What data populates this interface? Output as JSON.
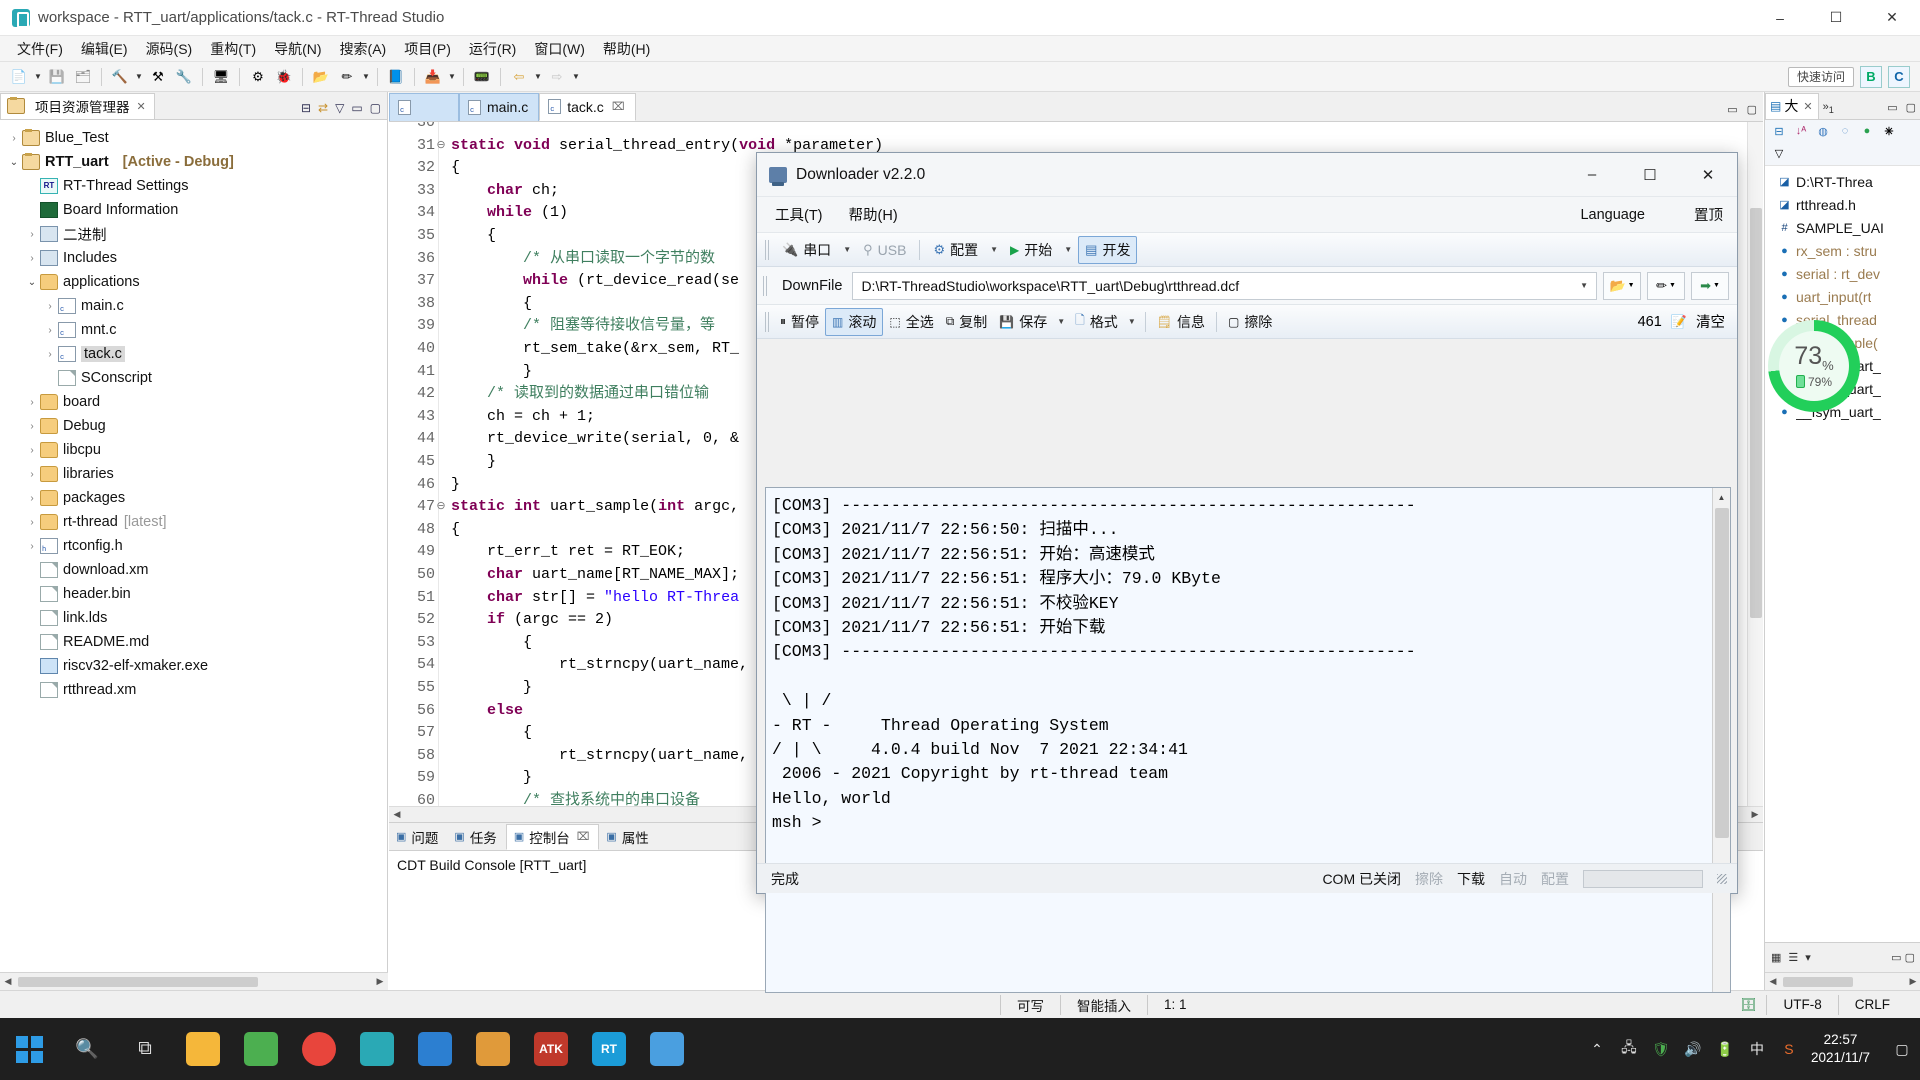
{
  "titlebar": {
    "title": "workspace - RTT_uart/applications/tack.c - RT-Thread Studio",
    "icon": "rt-thread-studio-icon",
    "minimize": "–",
    "maximize": "☐",
    "close": "✕"
  },
  "menubar": {
    "items": [
      "文件(F)",
      "编辑(E)",
      "源码(S)",
      "重构(T)",
      "导航(N)",
      "搜索(A)",
      "项目(P)",
      "运行(R)",
      "窗口(W)",
      "帮助(H)"
    ]
  },
  "toolbar": {
    "quick_access": "快速访问",
    "perspective_b": "B",
    "perspective_c": "C",
    "items": [
      {
        "name": "new-icon",
        "glyph": "Ὄ4"
      },
      {
        "name": "save-icon",
        "glyph": "ὋE"
      },
      {
        "name": "save-all-icon",
        "glyph": "὚B"
      },
      {
        "name": "build-hammer-icon",
        "glyph": "ὒ8"
      },
      {
        "name": "clean-icon",
        "glyph": "⚒"
      },
      {
        "name": "wrench-icon",
        "glyph": "ὒ7"
      },
      {
        "name": "console-icon",
        "glyph": "Ὓ5"
      },
      {
        "name": "debug-gear-icon",
        "glyph": "⚙"
      },
      {
        "name": "bug-icon",
        "glyph": "ὁB"
      },
      {
        "name": "open-folder-icon",
        "glyph": "Ὄ2"
      },
      {
        "name": "pencil-icon",
        "glyph": "✏"
      },
      {
        "name": "book-icon",
        "glyph": "Ὅ8"
      },
      {
        "name": "download-icon",
        "glyph": "⬇"
      },
      {
        "name": "terminal-icon",
        "glyph": "ὍF"
      },
      {
        "name": "back-arrow-icon",
        "glyph": "⇐"
      },
      {
        "name": "forward-arrow-icon",
        "glyph": "⇒"
      }
    ]
  },
  "project_explorer": {
    "tab_label": "项目资源管理器",
    "tree": [
      {
        "indent": 0,
        "arrow": "collapsed",
        "icon": "project-icon",
        "label": "Blue_Test",
        "bold": false,
        "meta": ""
      },
      {
        "indent": 0,
        "arrow": "expanded",
        "icon": "project-icon",
        "label": "RTT_uart",
        "bold": true,
        "meta": "[Active - Debug]"
      },
      {
        "indent": 1,
        "arrow": "none",
        "icon": "rt-settings-icon",
        "label": "RT-Thread Settings",
        "bold": false,
        "meta": ""
      },
      {
        "indent": 1,
        "arrow": "none",
        "icon": "board-icon",
        "label": "Board Information",
        "bold": false,
        "meta": ""
      },
      {
        "indent": 1,
        "arrow": "collapsed",
        "icon": "binary-icon",
        "label": "二进制",
        "bold": false,
        "meta": ""
      },
      {
        "indent": 1,
        "arrow": "collapsed",
        "icon": "includes-icon",
        "label": "Includes",
        "bold": false,
        "meta": ""
      },
      {
        "indent": 1,
        "arrow": "expanded",
        "icon": "folder-icon",
        "label": "applications",
        "bold": false,
        "meta": ""
      },
      {
        "indent": 2,
        "arrow": "collapsed",
        "icon": "c-file-icon",
        "label": "main.c",
        "bold": false,
        "meta": ""
      },
      {
        "indent": 2,
        "arrow": "collapsed",
        "icon": "c-file-icon",
        "label": "mnt.c",
        "bold": false,
        "meta": ""
      },
      {
        "indent": 2,
        "arrow": "collapsed",
        "icon": "c-file-icon",
        "label": "tack.c",
        "bold": false,
        "meta": "",
        "selected": true
      },
      {
        "indent": 2,
        "arrow": "none",
        "icon": "file-icon",
        "label": "SConscript",
        "bold": false,
        "meta": ""
      },
      {
        "indent": 1,
        "arrow": "collapsed",
        "icon": "folder-icon",
        "label": "board",
        "bold": false,
        "meta": ""
      },
      {
        "indent": 1,
        "arrow": "collapsed",
        "icon": "folder-icon",
        "label": "Debug",
        "bold": false,
        "meta": ""
      },
      {
        "indent": 1,
        "arrow": "collapsed",
        "icon": "folder-icon",
        "label": "libcpu",
        "bold": false,
        "meta": ""
      },
      {
        "indent": 1,
        "arrow": "collapsed",
        "icon": "folder-icon",
        "label": "libraries",
        "bold": false,
        "meta": ""
      },
      {
        "indent": 1,
        "arrow": "collapsed",
        "icon": "folder-icon",
        "label": "packages",
        "bold": false,
        "meta": ""
      },
      {
        "indent": 1,
        "arrow": "collapsed",
        "icon": "folder-icon",
        "label": "rt-thread",
        "bold": false,
        "meta2": "[latest]"
      },
      {
        "indent": 1,
        "arrow": "collapsed",
        "icon": "h-file-icon",
        "label": "rtconfig.h",
        "bold": false,
        "meta": ""
      },
      {
        "indent": 1,
        "arrow": "none",
        "icon": "file-icon",
        "label": "download.xm",
        "bold": false,
        "meta": ""
      },
      {
        "indent": 1,
        "arrow": "none",
        "icon": "file-icon",
        "label": "header.bin",
        "bold": false,
        "meta": ""
      },
      {
        "indent": 1,
        "arrow": "none",
        "icon": "file-icon",
        "label": "link.lds",
        "bold": false,
        "meta": ""
      },
      {
        "indent": 1,
        "arrow": "none",
        "icon": "file-icon",
        "label": "README.md",
        "bold": false,
        "meta": ""
      },
      {
        "indent": 1,
        "arrow": "none",
        "icon": "exe-icon",
        "label": "riscv32-elf-xmaker.exe",
        "bold": false,
        "meta": ""
      },
      {
        "indent": 1,
        "arrow": "none",
        "icon": "file-icon",
        "label": "rtthread.xm",
        "bold": false,
        "meta": ""
      }
    ]
  },
  "editor": {
    "tabs": [
      {
        "label": "",
        "state": "blank"
      },
      {
        "label": "main.c",
        "state": "inactive"
      },
      {
        "label": "tack.c",
        "state": "active",
        "close": "⌧"
      }
    ],
    "lines": [
      {
        "num": "30",
        "fold": "",
        "text": "",
        "partial": true
      },
      {
        "num": "31",
        "fold": "⊖",
        "text": "static void serial_thread_entry(void *parameter)"
      },
      {
        "num": "32",
        "fold": "",
        "text": "{"
      },
      {
        "num": "33",
        "fold": "",
        "text": "    char ch;"
      },
      {
        "num": "34",
        "fold": "",
        "text": "    while (1)"
      },
      {
        "num": "35",
        "fold": "",
        "text": "    {"
      },
      {
        "num": "36",
        "fold": "",
        "text": "        /* 从串口读取一个字节的数"
      },
      {
        "num": "37",
        "fold": "",
        "text": "        while (rt_device_read(se"
      },
      {
        "num": "38",
        "fold": "",
        "text": "        {"
      },
      {
        "num": "39",
        "fold": "",
        "text": "        /* 阻塞等待接收信号量，等"
      },
      {
        "num": "40",
        "fold": "",
        "text": "        rt_sem_take(&rx_sem, RT_"
      },
      {
        "num": "41",
        "fold": "",
        "text": "        }"
      },
      {
        "num": "42",
        "fold": "",
        "text": "    /* 读取到的数据通过串口错位输"
      },
      {
        "num": "43",
        "fold": "",
        "text": "    ch = ch + 1;"
      },
      {
        "num": "44",
        "fold": "",
        "text": "    rt_device_write(serial, 0, &"
      },
      {
        "num": "45",
        "fold": "",
        "text": "    }"
      },
      {
        "num": "46",
        "fold": "",
        "text": "}"
      },
      {
        "num": "47",
        "fold": "⊖",
        "text": "static int uart_sample(int argc,"
      },
      {
        "num": "48",
        "fold": "",
        "text": "{"
      },
      {
        "num": "49",
        "fold": "",
        "text": "    rt_err_t ret = RT_EOK;"
      },
      {
        "num": "50",
        "fold": "",
        "text": "    char uart_name[RT_NAME_MAX];"
      },
      {
        "num": "51",
        "fold": "",
        "text": "    char str[] = \"hello RT-Threa"
      },
      {
        "num": "52",
        "fold": "",
        "text": "    if (argc == 2)"
      },
      {
        "num": "53",
        "fold": "",
        "text": "        {"
      },
      {
        "num": "54",
        "fold": "",
        "text": "            rt_strncpy(uart_name,"
      },
      {
        "num": "55",
        "fold": "",
        "text": "        }"
      },
      {
        "num": "56",
        "fold": "",
        "text": "    else"
      },
      {
        "num": "57",
        "fold": "",
        "text": "        {"
      },
      {
        "num": "58",
        "fold": "",
        "text": "            rt_strncpy(uart_name,"
      },
      {
        "num": "59",
        "fold": "",
        "text": "        }"
      },
      {
        "num": "60",
        "fold": "",
        "text": "        /* 查找系统中的串口设备 "
      }
    ]
  },
  "bottom_panel": {
    "tabs": [
      {
        "label": "问题",
        "icon": "problems-icon",
        "active": false
      },
      {
        "label": "任务",
        "icon": "tasks-icon",
        "active": false
      },
      {
        "label": "控制台",
        "icon": "console-icon",
        "active": true,
        "close": "⌧"
      },
      {
        "label": "属性",
        "icon": "properties-icon",
        "active": false
      }
    ],
    "content": "CDT Build Console [RTT_uart]"
  },
  "outline_panel": {
    "tab_label": "大",
    "overflow_label": "»",
    "overflow_count": "1",
    "tools": [
      "collapse-all-icon",
      "sort-icon",
      "hide-fields-icon",
      "hide-static-icon",
      "hide-nonpublic-icon",
      "filter-icon",
      "menu-icon"
    ],
    "items": [
      {
        "icon": "include-icon",
        "text": "D:\\RT-Threa",
        "dim": false
      },
      {
        "icon": "include-icon",
        "text": "rtthread.h",
        "dim": false
      },
      {
        "icon": "define-icon",
        "text": "SAMPLE_UAI",
        "dim": false
      },
      {
        "icon": "var-static-icon",
        "text": "rx_sem : stru",
        "dim": true
      },
      {
        "icon": "var-static-icon",
        "text": "serial : rt_dev",
        "dim": true
      },
      {
        "icon": "func-static-icon",
        "text": "uart_input(rt",
        "dim": true
      },
      {
        "icon": "func-static-icon",
        "text": "serial_thread",
        "dim": true
      },
      {
        "icon": "func-static-icon",
        "text": "uart_sample(",
        "dim": true
      },
      {
        "icon": "const-icon",
        "text": "__fsym_uart_",
        "dim": false
      },
      {
        "icon": "const-icon",
        "text": "__fsym_uart_",
        "dim": false
      },
      {
        "icon": "const-icon",
        "text": "__fsym_uart_",
        "dim": false
      }
    ],
    "battery": {
      "percent_main": "73",
      "percent_unit": "%",
      "percent_sub": "79%",
      "ring_color": "#22cf5a"
    }
  },
  "eclipse_status": {
    "writable": "可写",
    "insert_mode": "智能插入",
    "position": "1: 1",
    "encoding": "UTF-8",
    "line_ending": "CRLF"
  },
  "downloader": {
    "title": "Downloader v2.2.0",
    "win_min": "–",
    "win_max": "☐",
    "win_close": "✕",
    "menus": [
      "工具(T)",
      "帮助(H)"
    ],
    "language": "Language",
    "always_on_top": "置顶",
    "toolbar1": [
      {
        "label": "串口",
        "icon": "serial-port-icon",
        "caret": true,
        "state": "normal"
      },
      {
        "label": "USB",
        "icon": "usb-icon",
        "caret": false,
        "state": "disabled"
      },
      {
        "label": "配置",
        "icon": "config-icon",
        "caret": true,
        "state": "normal"
      },
      {
        "label": "开始",
        "icon": "play-icon",
        "caret": true,
        "state": "normal"
      },
      {
        "label": "开发",
        "icon": "develop-icon",
        "caret": false,
        "state": "selected"
      }
    ],
    "downfile": {
      "label": "DownFile",
      "value": "D:\\RT-ThreadStudio\\workspace\\RTT_uart\\Debug\\rtthread.dcf",
      "browse_icon": "open-folder-icon",
      "edit_icon": "pencil-icon",
      "export_icon": "export-icon"
    },
    "toolbar2": [
      {
        "label": "暂停",
        "icon": "pause-icon",
        "state": "normal"
      },
      {
        "label": "滚动",
        "icon": "scroll-icon",
        "state": "selected"
      },
      {
        "label": "全选",
        "icon": "select-all-icon",
        "state": "normal"
      },
      {
        "label": "复制",
        "icon": "copy-icon",
        "state": "normal"
      },
      {
        "label": "保存",
        "icon": "save-icon",
        "state": "normal",
        "caret": true
      },
      {
        "label": "格式",
        "icon": "format-icon",
        "state": "normal",
        "caret": true
      },
      {
        "label": "信息",
        "icon": "info-icon",
        "state": "normal"
      },
      {
        "label": "擦除",
        "icon": "erase-icon",
        "state": "normal"
      }
    ],
    "counter": "461",
    "clear_label": "清空",
    "clear_icon": "clear-list-icon",
    "terminal_lines": [
      "[COM3] ----------------------------------------------------------",
      "[COM3] 2021/11/7 22:56:50: 扫描中...",
      "[COM3] 2021/11/7 22:56:51: 开始：高速模式",
      "[COM3] 2021/11/7 22:56:51: 程序大小：79.0 KByte",
      "[COM3] 2021/11/7 22:56:51: 不校验KEY",
      "[COM3] 2021/11/7 22:56:51: 开始下载",
      "[COM3] ----------------------------------------------------------",
      "",
      " \\ | /",
      "- RT -     Thread Operating System",
      "/ | \\     4.0.4 build Nov  7 2021 22:34:41",
      " 2006 - 2021 Copyright by rt-thread team",
      "Hello, world",
      "msh >"
    ],
    "status": {
      "left": "完成",
      "com_state": "COM 已关闭",
      "erase": "擦除",
      "download": "下载",
      "auto": "自动",
      "config": "配置"
    }
  },
  "taskbar": {
    "start_icon": "windows-start-icon",
    "search_icon": "search-icon",
    "taskview_icon": "task-view-icon",
    "apps": [
      {
        "name": "file-explorer-icon",
        "label": "",
        "color": "#f5b73a"
      },
      {
        "name": "green-app-icon",
        "label": "",
        "color": "#4caf50"
      },
      {
        "name": "chrome-icon",
        "label": "",
        "color": "#e8453c"
      },
      {
        "name": "rt-thread-studio-icon",
        "label": "",
        "color": "#2aa9b5"
      },
      {
        "name": "vscode-icon",
        "label": "",
        "color": "#2c7fd1"
      },
      {
        "name": "sublime-icon",
        "label": "",
        "color": "#e09a3a"
      },
      {
        "name": "atk-xcom-icon",
        "label": "ATK",
        "color": "#c0392b"
      },
      {
        "name": "rt-downloader-icon",
        "label": "RT",
        "color": "#1b9cd8"
      },
      {
        "name": "phone-app-icon",
        "label": "",
        "color": "#4a9fe0"
      }
    ],
    "tray": [
      "chevron-up-icon",
      "network-icon",
      "shield-icon",
      "volume-icon",
      "battery-icon",
      "ime-cn-icon",
      "sogou-icon"
    ],
    "ime": "中",
    "clock_time": "22:57",
    "clock_date": "2021/11/7",
    "notification_icon": "notification-icon"
  }
}
